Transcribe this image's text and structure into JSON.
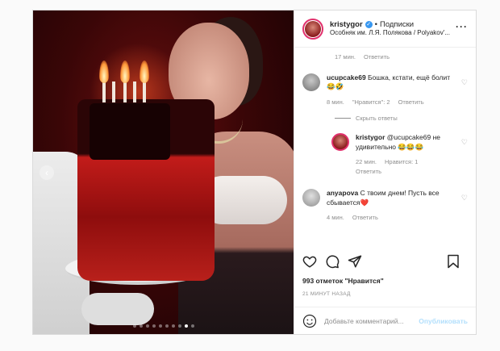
{
  "header": {
    "username": "kristygor",
    "separator": "•",
    "follow_status": "Подписки",
    "location": "Особняк им. Л.Я. Полякова / Polyakov'..."
  },
  "comments": {
    "first_meta": {
      "time": "17 мин.",
      "reply": "Ответить"
    },
    "c1": {
      "username": "ucupcake69",
      "text": "Бошка, кстати, ещё болит 😂🤣",
      "time": "8 мин.",
      "likes": "\"Нравится\": 2",
      "reply": "Ответить"
    },
    "hide_replies": "Скрыть ответы",
    "c2": {
      "username": "kristygor",
      "text": "@ucupcake69 не удивительно 😂😂😂",
      "time": "22 мин.",
      "likes": "Нравится: 1",
      "reply": "Ответить"
    },
    "c3": {
      "username": "anyapova",
      "text": "С твоим днем! Пусть все сбывается❤️",
      "time": "4 мин.",
      "reply": "Ответить"
    }
  },
  "likes": "993 отметок \"Нравится\"",
  "timestamp": "21 МИНУТ НАЗАД",
  "add_comment": {
    "placeholder": "Добавьте комментарий...",
    "post_label": "Опубликовать"
  },
  "carousel": {
    "total": 10,
    "active": 9
  },
  "icons": {
    "heart": "heart-icon",
    "comment": "comment-icon",
    "share": "share-icon",
    "bookmark": "bookmark-icon",
    "emoji": "emoji-icon",
    "more": "more-icon",
    "verified": "verified-icon",
    "prev": "chevron-left-icon"
  },
  "colors": {
    "verified": "#3897f0",
    "post_button": "#b2dffc",
    "story_ring": "#e1306c"
  }
}
